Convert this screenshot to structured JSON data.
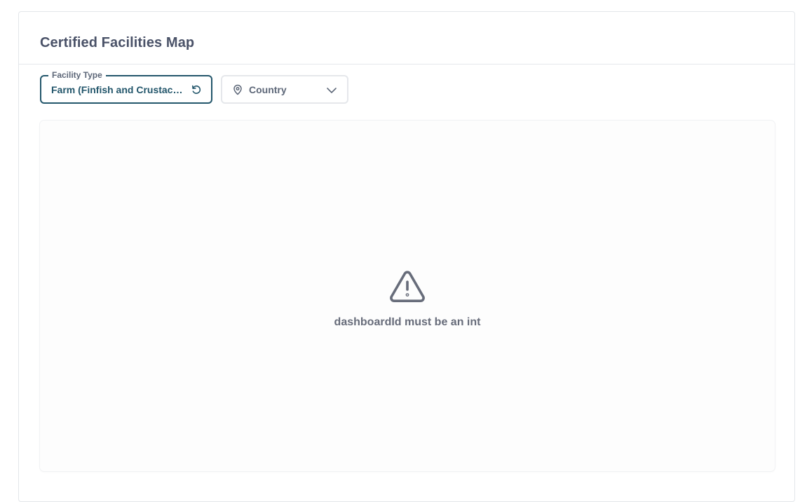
{
  "card": {
    "title": "Certified Facilities Map"
  },
  "filters": {
    "facility_type": {
      "label": "Facility Type",
      "value": "Farm (Finfish and Crustacea..."
    },
    "country": {
      "placeholder": "Country"
    }
  },
  "map": {
    "error_message": "dashboardId must be an int"
  },
  "icons": {
    "reset": "reset-icon",
    "location": "location-pin-icon",
    "dropdown": "chevron-down-icon",
    "warning": "warning-icon"
  },
  "colors": {
    "accent": "#23566b",
    "title": "#4a5268",
    "muted": "#5d6778",
    "error_text": "#676c7a"
  }
}
